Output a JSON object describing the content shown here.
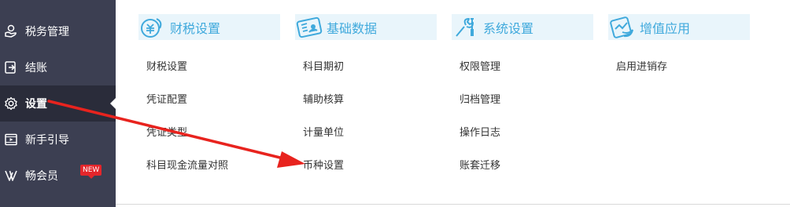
{
  "sidebar": {
    "items": [
      {
        "label": "税务管理",
        "icon": "hand-coin-icon"
      },
      {
        "label": "结账",
        "icon": "checkout-icon"
      },
      {
        "label": "设置",
        "icon": "gear-icon",
        "active": true
      },
      {
        "label": "新手引导",
        "icon": "video-guide-icon"
      },
      {
        "label": "畅会员",
        "icon": "vip-icon",
        "badge": "NEW"
      }
    ]
  },
  "menu": {
    "columns": [
      {
        "title": "财税设置",
        "icon": "finance-tax-icon",
        "links": [
          "财税设置",
          "凭证配置",
          "凭证类型",
          "科目现金流量对照"
        ]
      },
      {
        "title": "基础数据",
        "icon": "basic-data-icon",
        "links": [
          "科目期初",
          "辅助核算",
          "计量单位",
          "币种设置"
        ]
      },
      {
        "title": "系统设置",
        "icon": "system-tools-icon",
        "links": [
          "权限管理",
          "归档管理",
          "操作日志",
          "账套迁移"
        ]
      },
      {
        "title": "增值应用",
        "icon": "value-added-icon",
        "links": [
          "启用进销存"
        ]
      }
    ]
  },
  "annotation": {
    "arrow_color": "#e8231e"
  }
}
